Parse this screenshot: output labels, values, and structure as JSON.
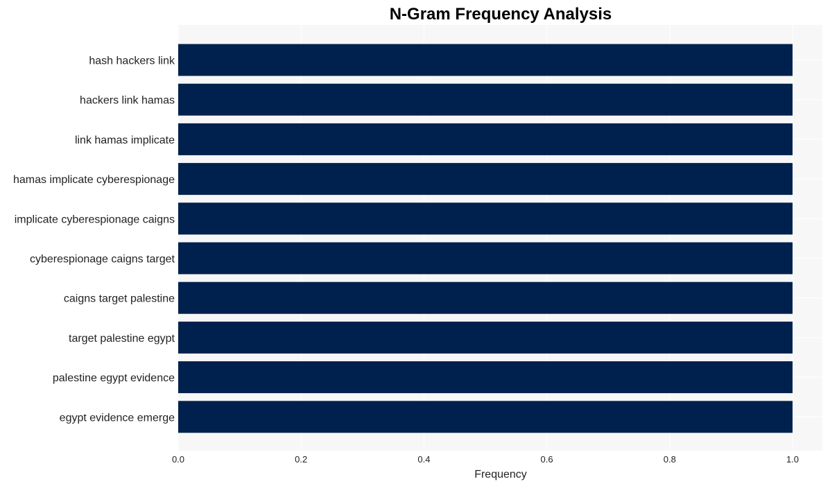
{
  "chart_data": {
    "type": "bar",
    "orientation": "horizontal",
    "title": "N-Gram Frequency Analysis",
    "xlabel": "Frequency",
    "ylabel": "",
    "categories": [
      "hash hackers link",
      "hackers link hamas",
      "link hamas implicate",
      "hamas implicate cyberespionage",
      "implicate cyberespionage caigns",
      "cyberespionage caigns target",
      "caigns target palestine",
      "target palestine egypt",
      "palestine egypt evidence",
      "egypt evidence emerge"
    ],
    "values": [
      1,
      1,
      1,
      1,
      1,
      1,
      1,
      1,
      1,
      1
    ],
    "xticks": [
      "0.0",
      "0.2",
      "0.4",
      "0.6",
      "0.8",
      "1.0"
    ],
    "xtick_values": [
      0,
      0.2,
      0.4,
      0.6,
      0.8,
      1.0
    ],
    "xlim": [
      0,
      1.05
    ],
    "grid": true,
    "colors": {
      "bar": "#00214d",
      "plot_bg": "#f7f7f7",
      "grid": "#ffffff"
    }
  }
}
